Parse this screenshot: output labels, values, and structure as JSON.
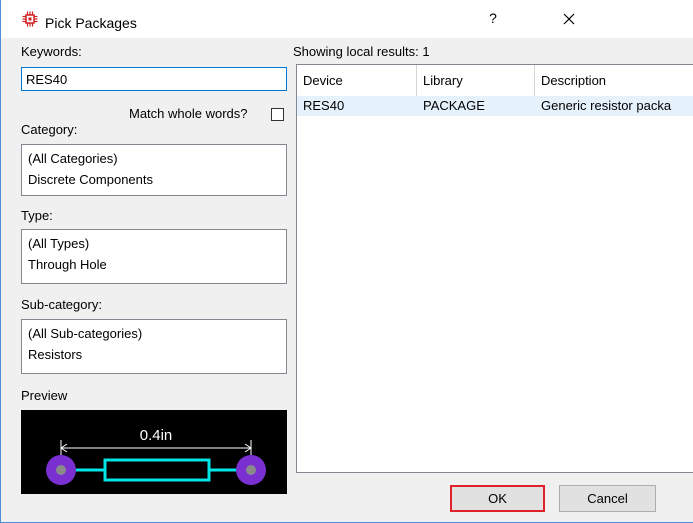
{
  "window": {
    "title": "Pick Packages",
    "help_label": "?"
  },
  "filters": {
    "keywords_label": "Keywords:",
    "keywords_value": "RES40",
    "match_whole_words_label": "Match whole words?",
    "match_whole_words_checked": false,
    "category_label": "Category:",
    "category_items": [
      "(All Categories)",
      "Discrete Components"
    ],
    "type_label": "Type:",
    "type_items": [
      "(All Types)",
      "Through Hole"
    ],
    "subcategory_label": "Sub-category:",
    "subcategory_items": [
      "(All Sub-categories)",
      "Resistors"
    ],
    "preview_label": "Preview",
    "preview_dimension": "0.4in"
  },
  "results": {
    "status": "Showing local results: 1",
    "columns": [
      "Device",
      "Library",
      "Description"
    ],
    "rows": [
      {
        "device": "RES40",
        "library": "PACKAGE",
        "description": "Generic resistor packa"
      }
    ]
  },
  "buttons": {
    "ok": "OK",
    "cancel": "Cancel"
  },
  "colors": {
    "accent": "#0078d7",
    "highlight_border": "#e0202a",
    "pad": "#7a2fd0",
    "body": "#00e5e5",
    "selected_row": "#e5f1fb"
  },
  "icons": [
    "chip-icon",
    "help-icon",
    "close-icon"
  ]
}
